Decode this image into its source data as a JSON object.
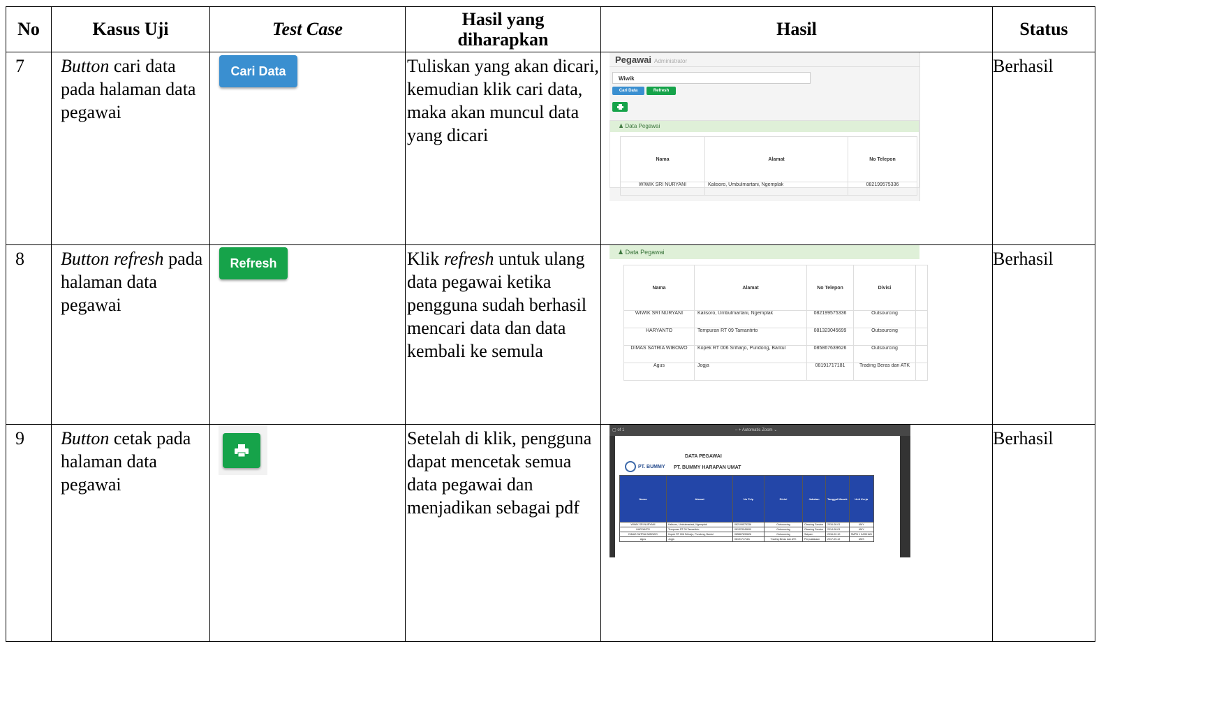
{
  "headers": {
    "no": "No",
    "kasus_uji": "Kasus Uji",
    "test_case": "Test Case",
    "hasil_diharapkan_1": "Hasil yang",
    "hasil_diharapkan_2": "diharapkan",
    "hasil": "Hasil",
    "status": "Status"
  },
  "rows": [
    {
      "no": "7",
      "kasus_italic": "Button",
      "kasus_rest": " cari data pada halaman data pegawai",
      "button_label": "Cari Data",
      "expected": "Tuliskan yang akan dicari, kemudian klik cari data, maka akan muncul data yang dicari",
      "status": "Berhasil",
      "shot": {
        "title": "Pegawai",
        "subtitle": "Administrator",
        "search_value": "Wiwik",
        "cari_label": "Cari Data",
        "refresh_label": "Refresh",
        "panel_title": "Data Pegawai",
        "cols": [
          "Nama",
          "Alamat",
          "No Telepon"
        ],
        "row": [
          "WIWIK SRI NURYANI",
          "Kalisoro, Umbulmartani, Ngemplak",
          "082199575336"
        ]
      }
    },
    {
      "no": "8",
      "kasus_italic": "Button refresh",
      "kasus_rest": " pada halaman data pegawai",
      "button_label": "Refresh",
      "expected_pre": "Klik ",
      "expected_italic": "refresh",
      "expected_post": " untuk ulang data pegawai ketika pengguna sudah berhasil mencari data dan data kembali ke semula",
      "status": "Berhasil",
      "shot": {
        "panel_title": "Data Pegawai",
        "cols": [
          "Nama",
          "Alamat",
          "No Telepon",
          "Divisi"
        ],
        "rows": [
          [
            "WIWIK SRI NURYANI",
            "Kalisoro, Umbulmartani, Ngemplak",
            "082199575336",
            "Outsourcing"
          ],
          [
            "HARYANTO",
            "Tempuran RT 09 Tamantirto",
            "081323045699",
            "Outsourcing"
          ],
          [
            "DIMAS SATRIA WIBOWO",
            "Kopek RT 006 Sriharjo, Pundong, Bantul",
            "085867639626",
            "Outsourcing"
          ],
          [
            "Agus",
            "Jogja",
            "08191717181",
            "Trading Beras dan ATK"
          ]
        ]
      }
    },
    {
      "no": "9",
      "kasus_italic": "Button",
      "kasus_rest": " cetak pada halaman data pegawai",
      "button_icon": "printer-icon",
      "expected": "Setelah di klik, pengguna dapat mencetak semua data pegawai dan menjadikan sebagai pdf",
      "status": "Berhasil",
      "shot": {
        "toolbar_zoom": "Automatic Zoom",
        "toolbar_page": "of 1",
        "logo_text": "PT. BUMMY",
        "doc_title": "DATA PEGAWAI",
        "company": "PT. BUMMY HARAPAN UMAT",
        "cols": [
          "Nama",
          "Alamat",
          "No Telp",
          "Divisi",
          "Jabatan",
          "Tanggal Masuk",
          "Unit Kerja"
        ],
        "rows": [
          [
            "WIWIK SRI NURYANI",
            "Kalisoro, Umbulmartani, Ngemplak",
            "082199575336",
            "Outsourcing",
            "Cleaning Service",
            "2016-08-01",
            "UMY"
          ],
          [
            "HARYANTO",
            "Tempuran RT 09 Tamantirto",
            "081323045699",
            "Outsourcing",
            "Cleaning Service",
            "2014-08-01",
            "UMY"
          ],
          [
            "DIMAS SATRIA WIBOWO",
            "Kopek RT 006 Sriharjo, Pundong, Bantul",
            "085867639626",
            "Outsourcing",
            "Satpam",
            "2016-02-10",
            "SMPN 1 KASIHAN"
          ],
          [
            "Agus",
            "Jogja",
            "08191717181",
            "Trading Beras dan ATK",
            "Perpustakaan",
            "2017-09-12",
            "UMS"
          ]
        ]
      }
    }
  ],
  "colors": {
    "button_blue": "#3a8fd0",
    "button_green": "#16a34a",
    "panel_green": "#dff0d8",
    "pdf_header_blue": "#2346a8"
  }
}
